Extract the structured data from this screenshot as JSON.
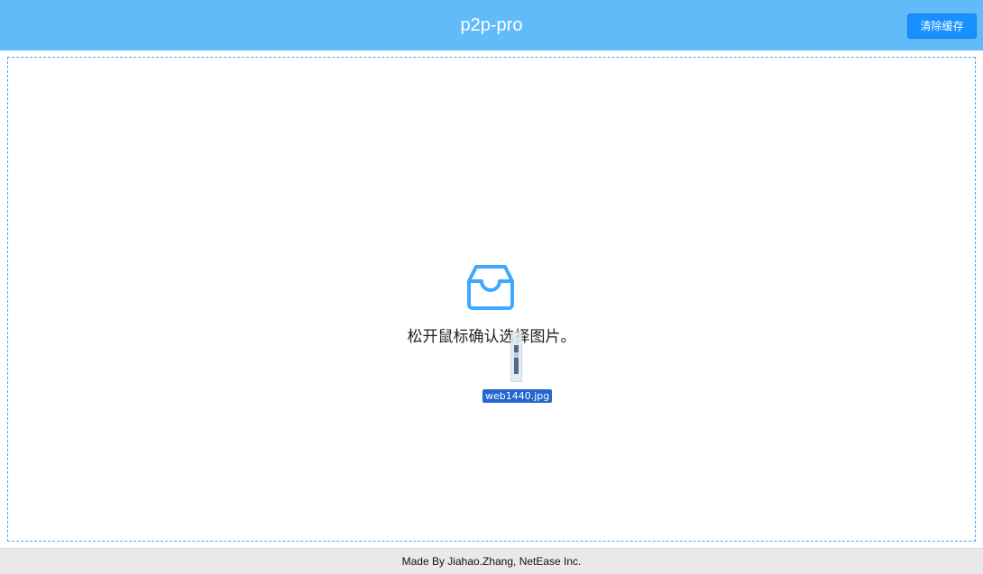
{
  "header": {
    "title": "p2p-pro",
    "clear_cache_label": "清除缓存"
  },
  "dropzone": {
    "icon": "inbox-icon",
    "hint": "松开鼠标确认选择图片。",
    "dragging_file": {
      "name": "web1440.jpg",
      "icon": "image-file-thumbnail"
    }
  },
  "footer": {
    "text": "Made By Jiahao.Zhang, NetEase Inc."
  },
  "colors": {
    "header_bg": "#61bbf8",
    "primary": "#1890ff",
    "dropzone_border": "#4fa6ef",
    "icon": "#40a9ff",
    "footer_bg": "#e9e9e9"
  }
}
